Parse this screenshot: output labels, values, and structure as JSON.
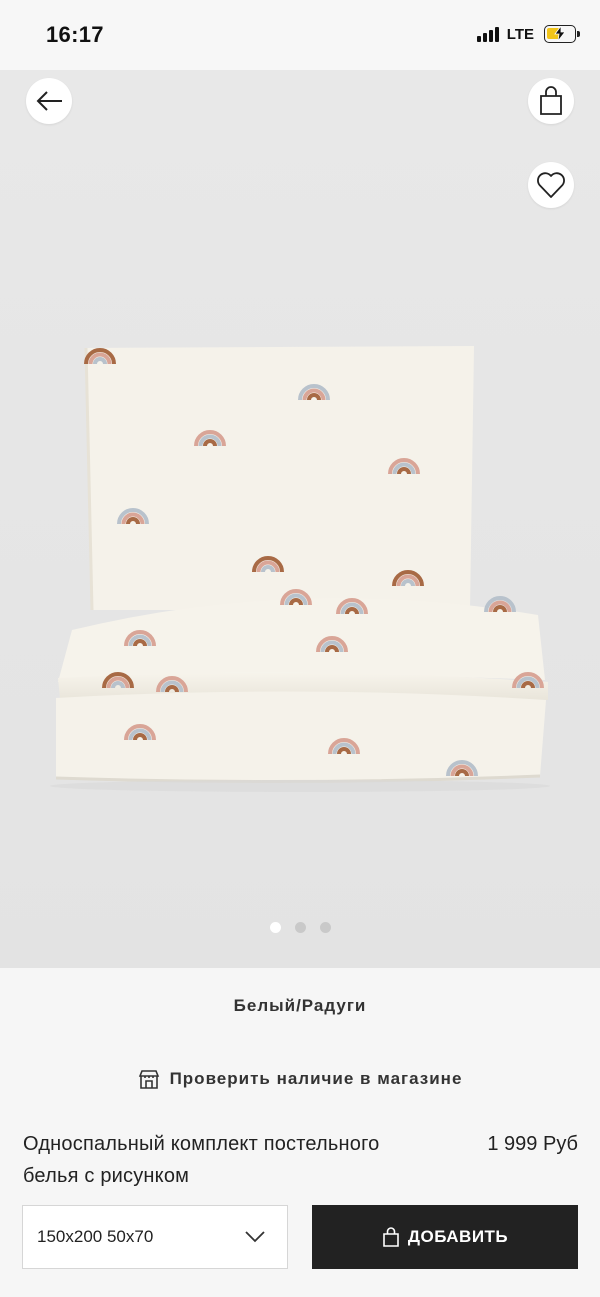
{
  "status_bar": {
    "time": "16:17",
    "network": "LTE",
    "icons": [
      "signal-icon",
      "battery-charging-icon"
    ]
  },
  "image": {
    "alt": "Белый/Радуги",
    "carousel_total": 3,
    "carousel_active": 1,
    "colors": {
      "fabric": "#f6f3ea",
      "rainbow_brown": "#a86a45",
      "rainbow_pink": "#d9a597",
      "rainbow_blue": "#b8c2cc",
      "backdrop": "#e6e6e6"
    }
  },
  "nav": {
    "back_icon": "arrow-left-icon",
    "bag_icon": "shopping-bag-icon",
    "favorite_icon": "heart-icon"
  },
  "product": {
    "color_name": "Белый/Радуги",
    "availability_label": "Проверить наличие в магазине",
    "title_line1": "Односпальный комплект постельного",
    "title_line2": "белья с рисунком",
    "price": "1 999 Руб",
    "size_selected": "150x200 50x70",
    "add_label": "ДОБАВИТЬ"
  },
  "colors": {
    "accent": "#222222",
    "background": "#f6f6f6",
    "battery": "#f2c51a"
  }
}
